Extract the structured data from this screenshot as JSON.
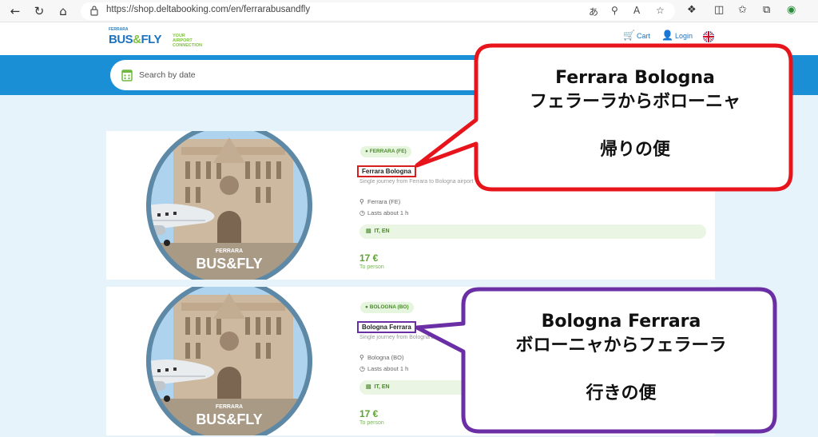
{
  "browser": {
    "url": "https://shop.deltabooking.com/en/ferrarabusandfly"
  },
  "header": {
    "logo_small": "FERRARA",
    "logo_bus": "BUS",
    "logo_amp": "&",
    "logo_fly": "FLY",
    "logo_tagline": "YOUR AIRPORT CONNECTION",
    "cart_label": "Cart",
    "login_label": "Login"
  },
  "search": {
    "placeholder": "Search by date"
  },
  "cards": [
    {
      "location_badge": "FERRARA (FE)",
      "title": "Ferrara Bologna",
      "description": "Single journey from Ferrara to Bologna airport",
      "place": "Ferrara (FE)",
      "duration": "Lasts about 1 h",
      "languages": "IT, EN",
      "price": "17 €",
      "price_note": "To person",
      "photo_brand_small": "FERRARA",
      "photo_brand": "BUS&FLY"
    },
    {
      "location_badge": "BOLOGNA (BO)",
      "title": "Bologna Ferrara",
      "description": "Single journey from Bologna airport to Ferrara",
      "place": "Bologna (BO)",
      "duration": "Lasts about 1 h",
      "languages": "IT, EN",
      "price": "17 €",
      "price_note": "To person",
      "photo_brand_small": "FERRARA",
      "photo_brand": "BUS&FLY"
    }
  ],
  "callouts": [
    {
      "line1": "Ferrara Bologna",
      "line2": "フェラーラからボローニャ",
      "line3": "帰りの便",
      "color": "#e8141b"
    },
    {
      "line1": "Bologna Ferrara",
      "line2": "ボローニャからフェラーラ",
      "line3": "行きの便",
      "color": "#6a2ea5"
    }
  ],
  "colors": {
    "brand_blue": "#1a8fd6",
    "brand_green": "#7fc241",
    "page_bg": "#e6f3fb"
  }
}
